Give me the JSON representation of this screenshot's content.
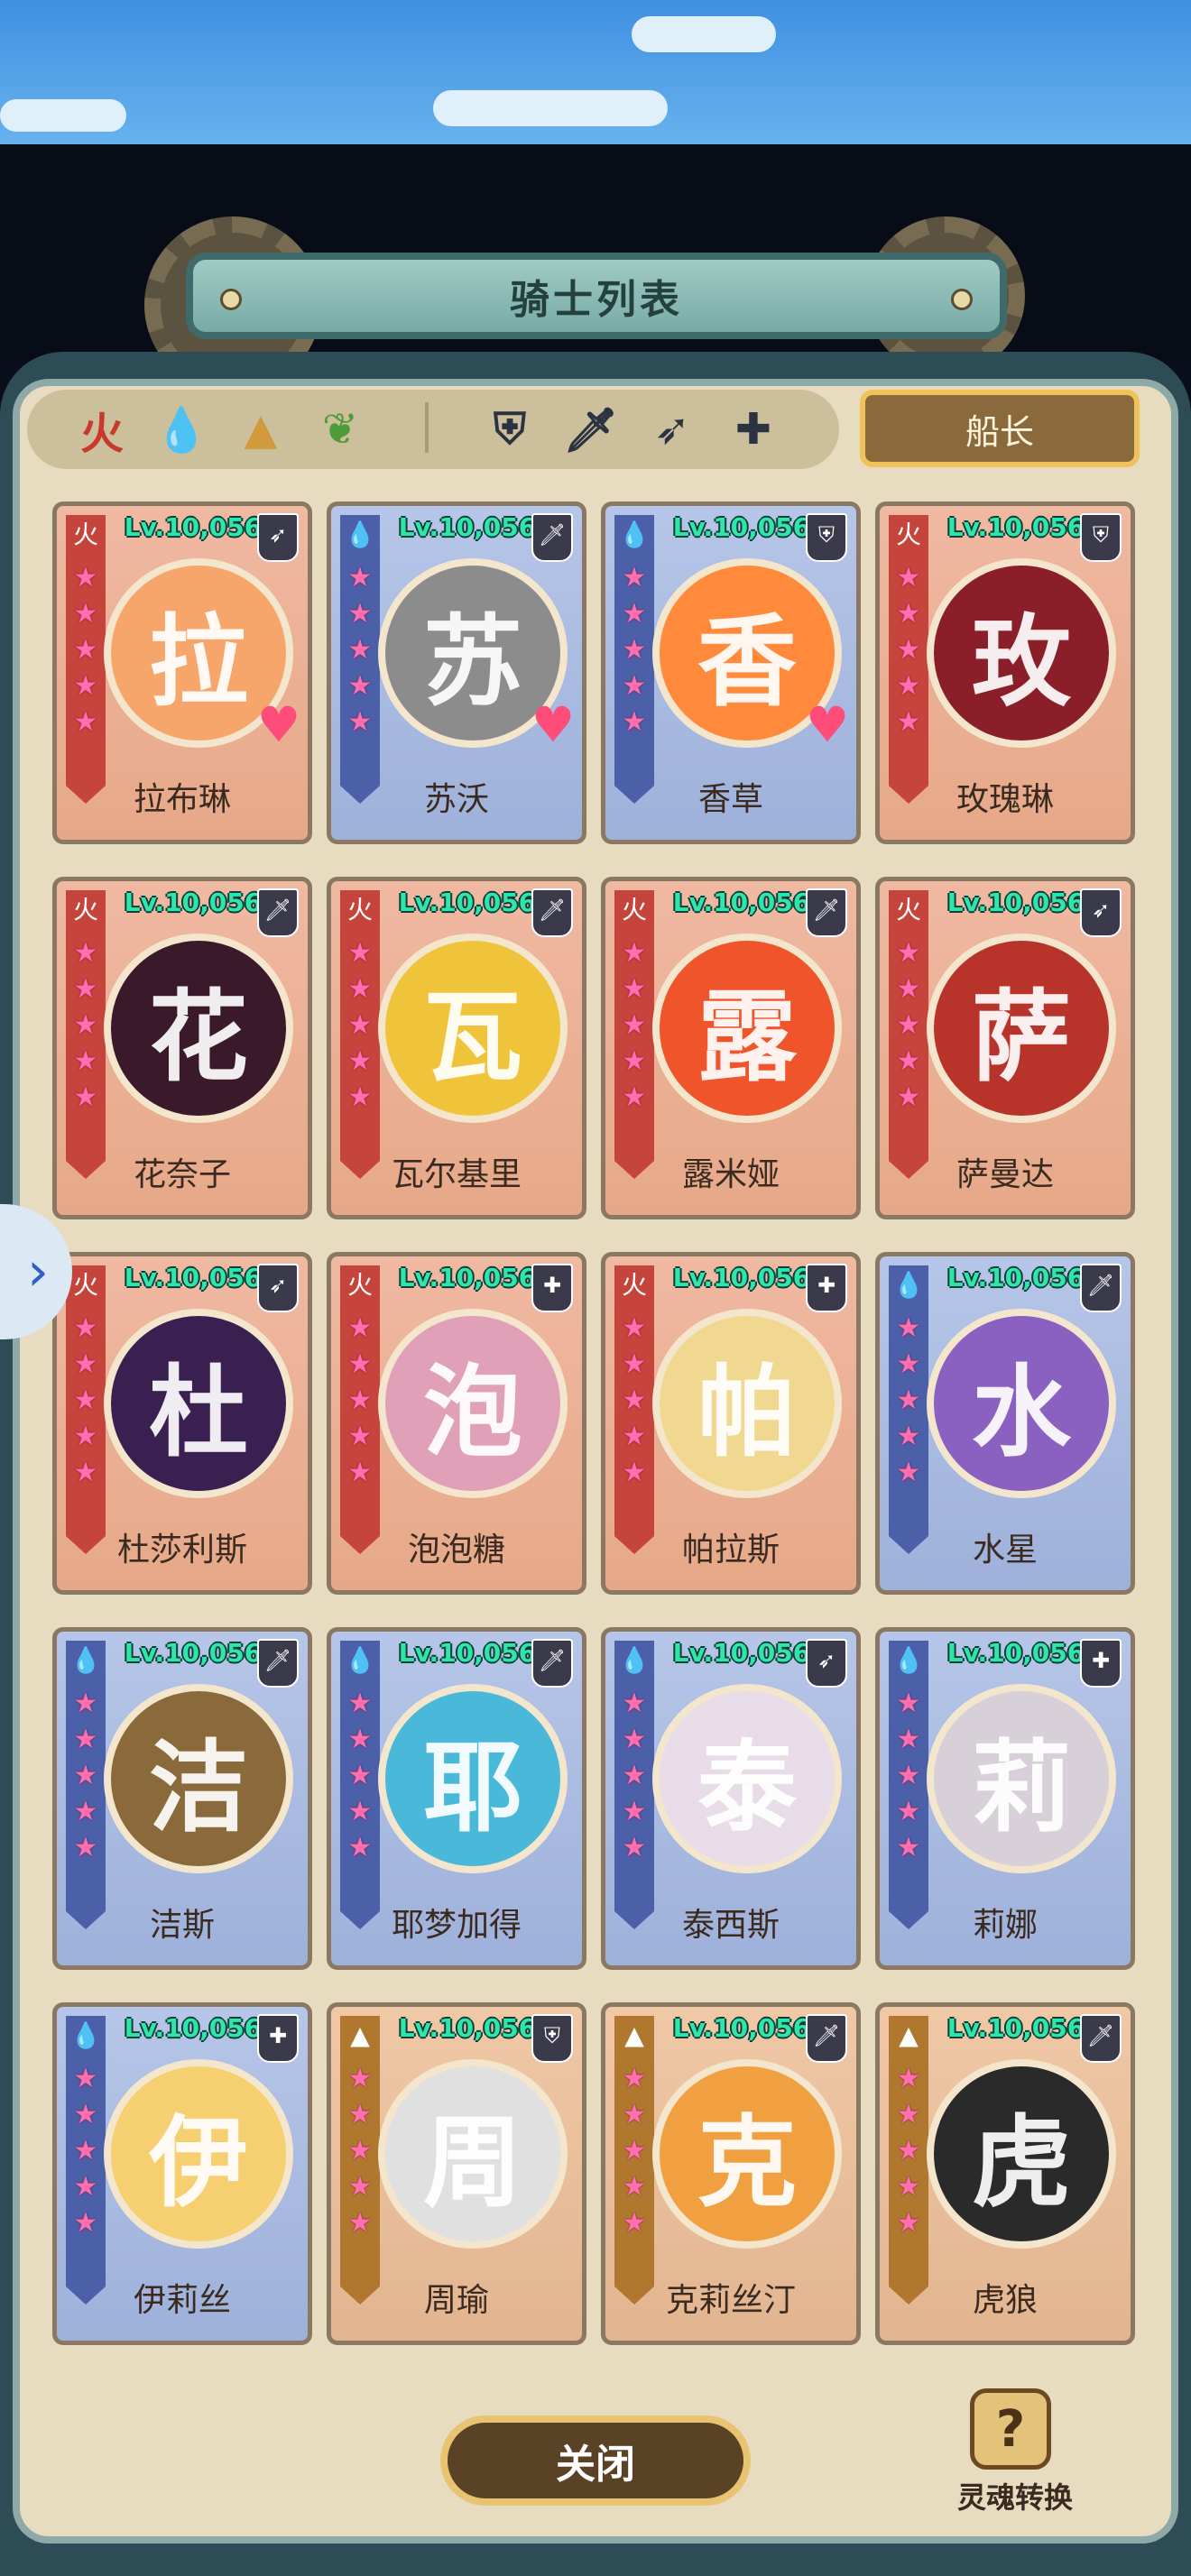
{
  "header": {
    "title": "骑士列表"
  },
  "filters": {
    "elements": [
      {
        "icon": "fire-element-icon",
        "glyph": "火",
        "color": "#c83a2e"
      },
      {
        "icon": "water-element-icon",
        "glyph": "💧",
        "color": "#3d6fd0"
      },
      {
        "icon": "earth-element-icon",
        "glyph": "▲",
        "color": "#d19a3c"
      },
      {
        "icon": "wind-element-icon",
        "glyph": "❦",
        "color": "#4e9b3a"
      }
    ],
    "classes": [
      {
        "icon": "shield-class-icon",
        "glyph": "⛨"
      },
      {
        "icon": "sword-class-icon",
        "glyph": "🗡"
      },
      {
        "icon": "bow-class-icon",
        "glyph": "➶"
      },
      {
        "icon": "healer-class-icon",
        "glyph": "✚"
      }
    ],
    "captain_label": "船长"
  },
  "knights": [
    {
      "name": "拉布琳",
      "level": "Lv.10,056",
      "element": "fire",
      "class_icon": "bow-class-icon",
      "class_glyph": "➶",
      "favorite": true,
      "stars": 5,
      "portrait_color": "#f6a56b"
    },
    {
      "name": "苏沃",
      "level": "Lv.10,056",
      "element": "water",
      "class_icon": "sword-class-icon",
      "class_glyph": "🗡",
      "favorite": true,
      "stars": 5,
      "portrait_color": "#8c8c8c"
    },
    {
      "name": "香草",
      "level": "Lv.10,056",
      "element": "water",
      "class_icon": "shield-class-icon",
      "class_glyph": "⛨",
      "favorite": true,
      "stars": 5,
      "portrait_color": "#ff8a3c"
    },
    {
      "name": "玫瑰琳",
      "level": "Lv.10,056",
      "element": "fire",
      "class_icon": "shield-class-icon",
      "class_glyph": "⛨",
      "favorite": false,
      "stars": 5,
      "portrait_color": "#8a1f2a"
    },
    {
      "name": "花奈子",
      "level": "Lv.10,056",
      "element": "fire",
      "class_icon": "sword-class-icon",
      "class_glyph": "🗡",
      "favorite": false,
      "stars": 5,
      "portrait_color": "#3a1a2a"
    },
    {
      "name": "瓦尔基里",
      "level": "Lv.10,056",
      "element": "fire",
      "class_icon": "sword-class-icon",
      "class_glyph": "🗡",
      "favorite": false,
      "stars": 5,
      "portrait_color": "#f0c43a"
    },
    {
      "name": "露米娅",
      "level": "Lv.10,056",
      "element": "fire",
      "class_icon": "sword-class-icon",
      "class_glyph": "🗡",
      "favorite": false,
      "stars": 5,
      "portrait_color": "#f0542a"
    },
    {
      "name": "萨曼达",
      "level": "Lv.10,056",
      "element": "fire",
      "class_icon": "bow-class-icon",
      "class_glyph": "➶",
      "favorite": false,
      "stars": 5,
      "portrait_color": "#b8342a"
    },
    {
      "name": "杜莎利斯",
      "level": "Lv.10,056",
      "element": "fire",
      "class_icon": "bow-class-icon",
      "class_glyph": "➶",
      "favorite": false,
      "stars": 5,
      "portrait_color": "#3a2050"
    },
    {
      "name": "泡泡糖",
      "level": "Lv.10,056",
      "element": "fire",
      "class_icon": "healer-class-icon",
      "class_glyph": "✚",
      "favorite": false,
      "stars": 5,
      "portrait_color": "#e0a0b8"
    },
    {
      "name": "帕拉斯",
      "level": "Lv.10,056",
      "element": "fire",
      "class_icon": "healer-class-icon",
      "class_glyph": "✚",
      "favorite": false,
      "stars": 5,
      "portrait_color": "#f0d890"
    },
    {
      "name": "水星",
      "level": "Lv.10,056",
      "element": "water",
      "class_icon": "sword-class-icon",
      "class_glyph": "🗡",
      "favorite": false,
      "stars": 5,
      "portrait_color": "#8a60c0"
    },
    {
      "name": "洁斯",
      "level": "Lv.10,056",
      "element": "water",
      "class_icon": "sword-class-icon",
      "class_glyph": "🗡",
      "favorite": false,
      "stars": 5,
      "portrait_color": "#8a6a3a"
    },
    {
      "name": "耶梦加得",
      "level": "Lv.10,056",
      "element": "water",
      "class_icon": "sword-class-icon",
      "class_glyph": "🗡",
      "favorite": false,
      "stars": 5,
      "portrait_color": "#4ab8d8"
    },
    {
      "name": "泰西斯",
      "level": "Lv.10,056",
      "element": "water",
      "class_icon": "bow-class-icon",
      "class_glyph": "➶",
      "favorite": false,
      "stars": 5,
      "portrait_color": "#e8dce8"
    },
    {
      "name": "莉娜",
      "level": "Lv.10,056",
      "element": "water",
      "class_icon": "healer-class-icon",
      "class_glyph": "✚",
      "favorite": false,
      "stars": 5,
      "portrait_color": "#d8d0d8"
    },
    {
      "name": "伊莉丝",
      "level": "Lv.10,056",
      "element": "water",
      "class_icon": "healer-class-icon",
      "class_glyph": "✚",
      "favorite": false,
      "stars": 5,
      "portrait_color": "#f5cf70"
    },
    {
      "name": "周瑜",
      "level": "Lv.10,056",
      "element": "earth",
      "class_icon": "shield-class-icon",
      "class_glyph": "⛨",
      "favorite": false,
      "stars": 5,
      "portrait_color": "#e0e0e0"
    },
    {
      "name": "克莉丝汀",
      "level": "Lv.10,056",
      "element": "earth",
      "class_icon": "sword-class-icon",
      "class_glyph": "🗡",
      "favorite": false,
      "stars": 5,
      "portrait_color": "#f0a040"
    },
    {
      "name": "虎狼",
      "level": "Lv.10,056",
      "element": "earth",
      "class_icon": "sword-class-icon",
      "class_glyph": "🗡",
      "favorite": false,
      "stars": 5,
      "portrait_color": "#2a2a2a"
    }
  ],
  "footer": {
    "close_label": "关闭",
    "soul_convert_label": "灵魂转换",
    "soul_convert_glyph": "?"
  },
  "side_arrow_glyph": "›",
  "element_glyphs": {
    "fire": "火",
    "water": "💧",
    "earth": "▲"
  },
  "star_glyph": "★",
  "heart_glyph": "♥"
}
